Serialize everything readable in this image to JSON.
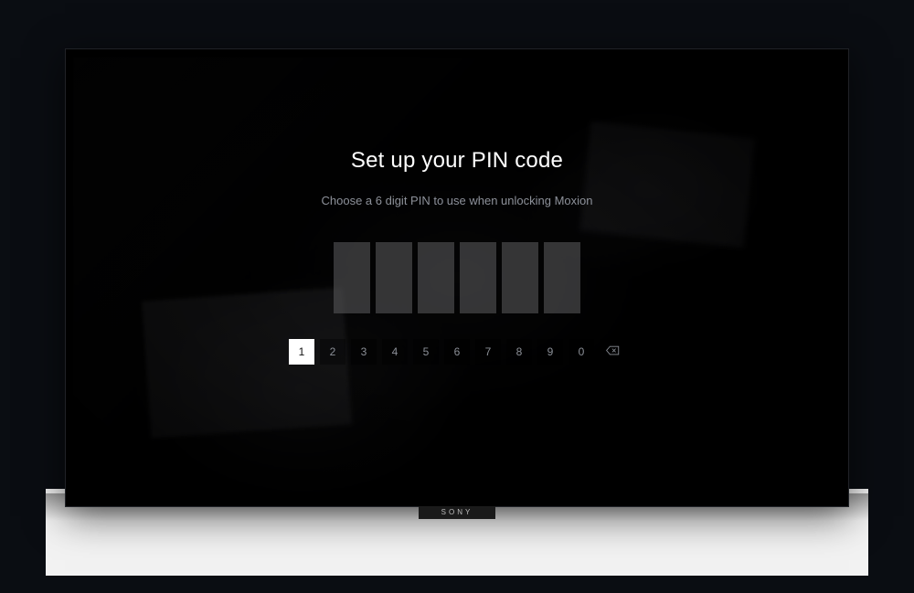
{
  "tv": {
    "brand": "SONY"
  },
  "pin_setup": {
    "title": "Set up your PIN code",
    "subtitle": "Choose a 6 digit PIN to use when unlocking Moxion",
    "slot_count": 6,
    "keys": [
      "1",
      "2",
      "3",
      "4",
      "5",
      "6",
      "7",
      "8",
      "9",
      "0"
    ],
    "selected_key": "1"
  }
}
